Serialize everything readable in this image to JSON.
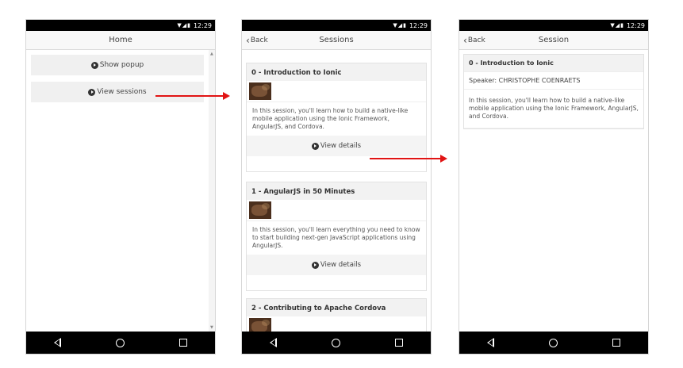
{
  "status": {
    "time": "12:29"
  },
  "home": {
    "title": "Home",
    "show_popup_label": "Show popup",
    "view_sessions_label": "View sessions"
  },
  "sessions": {
    "back_label": "Back",
    "title": "Sessions",
    "view_details_label": "View details",
    "items": [
      {
        "title": "0 - Introduction to Ionic",
        "description": "In this session, you'll learn how to build a native-like mobile application using the Ionic Framework, AngularJS, and Cordova."
      },
      {
        "title": "1 - AngularJS in 50 Minutes",
        "description": "In this session, you'll learn everything you need to know to start building next-gen JavaScript applications using AngularJS."
      },
      {
        "title": "2 - Contributing to Apache Cordova",
        "description": ""
      }
    ]
  },
  "session": {
    "back_label": "Back",
    "title": "Session",
    "session_title": "0 - Introduction to Ionic",
    "speaker": "Speaker: CHRISTOPHE COENRAETS",
    "description": "In this session, you'll learn how to build a native-like mobile application using the Ionic Framework, AngularJS, and Cordova."
  },
  "colors": {
    "arrow": "#e11414",
    "system_bar": "#000000",
    "button_bg": "#f0f0f0"
  },
  "icons": [
    "wifi-icon",
    "signal-icon",
    "battery-icon",
    "chevron-left-icon",
    "play-circle-icon",
    "android-back-icon",
    "android-home-icon",
    "android-recent-icon"
  ]
}
